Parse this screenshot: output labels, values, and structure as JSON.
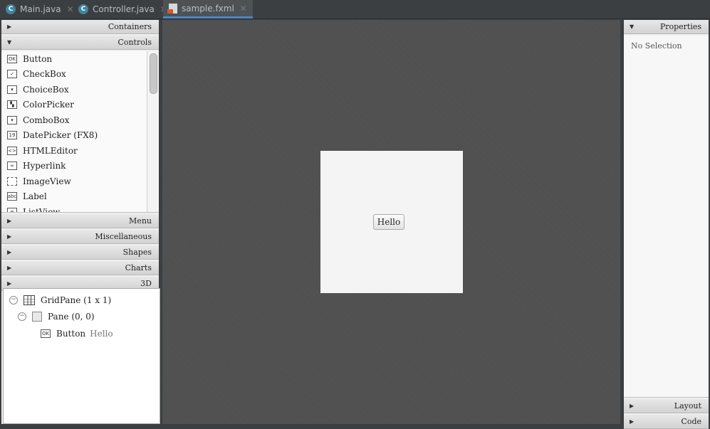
{
  "tabs": [
    {
      "label": "Main.java",
      "icon": "java-class-icon"
    },
    {
      "label": "Controller.java",
      "icon": "java-class-icon"
    },
    {
      "label": "sample.fxml",
      "icon": "fxml-file-icon"
    }
  ],
  "library": {
    "sections_top": [
      "Containers",
      "Controls"
    ],
    "controls": [
      {
        "label": "Button",
        "icon_text": "OK"
      },
      {
        "label": "CheckBox",
        "icon_text": "✓"
      },
      {
        "label": "ChoiceBox",
        "icon_text": "▾"
      },
      {
        "label": "ColorPicker",
        "icon_text": "▚"
      },
      {
        "label": "ComboBox",
        "icon_text": "▾"
      },
      {
        "label": "DatePicker  (FX8)",
        "icon_text": "19"
      },
      {
        "label": "HTMLEditor",
        "icon_text": "<>"
      },
      {
        "label": "Hyperlink",
        "icon_text": "∞"
      },
      {
        "label": "ImageView",
        "icon_text": ""
      },
      {
        "label": "Label",
        "icon_text": "abc"
      },
      {
        "label": "ListView",
        "icon_text": "≡"
      }
    ],
    "sections_bottom": [
      "Menu",
      "Miscellaneous",
      "Shapes",
      "Charts",
      "3D"
    ]
  },
  "hierarchy": {
    "gridpane": "GridPane (1 x 1)",
    "pane": "Pane (0, 0)",
    "button": "Button",
    "button_text": "Hello",
    "button_icon_text": "OK"
  },
  "canvas": {
    "button_label": "Hello"
  },
  "inspector": {
    "properties": "Properties",
    "no_selection": "No Selection",
    "layout": "Layout",
    "code": "Code"
  },
  "colors": {
    "accent": "#4a88c7",
    "canvas": "#535353",
    "tabbar": "#3c3f41"
  }
}
